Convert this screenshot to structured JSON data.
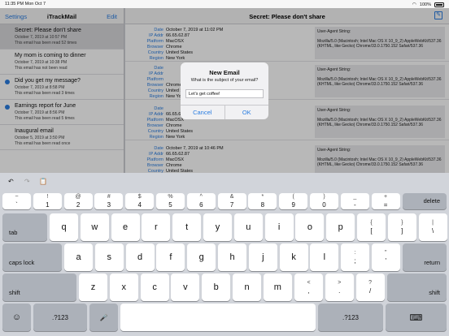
{
  "status_bar": {
    "time": "11:35 PM",
    "date": "Mon Oct 7",
    "battery": "100%"
  },
  "sidebar": {
    "left_button": "Settings",
    "title": "iTrackMail",
    "right_button": "Edit",
    "items": [
      {
        "subject": "Secret: Please don't share",
        "date": "October 7, 2019 at 10:57 PM",
        "read": "This email has been read 52 times",
        "unread": false,
        "selected": true
      },
      {
        "subject": "My mom is coming to dinner",
        "date": "October 7, 2019 at 10:38 PM",
        "read": "This email has not been read",
        "unread": false,
        "selected": false
      },
      {
        "subject": "Did you get my message?",
        "date": "October 7, 2019 at 8:58 PM",
        "read": "This email has been read 3 times",
        "unread": true,
        "selected": false
      },
      {
        "subject": "Earnings report for June",
        "date": "October 7, 2019 at 8:56 PM",
        "read": "This email has been read 5 times",
        "unread": true,
        "selected": false
      },
      {
        "subject": "Inaugural email",
        "date": "October 5, 2019 at 3:50 PM",
        "read": "This email has been read once",
        "unread": false,
        "selected": false
      }
    ]
  },
  "detail": {
    "title": "Secret: Please don't share",
    "entries": [
      {
        "date": "October 7, 2019 at 11:02 PM",
        "ip": "66.65.62.87",
        "platform": "MacOSX",
        "browser": "Chrome",
        "country": "United States",
        "region": "New York"
      },
      {
        "date": "",
        "ip": "",
        "platform": "",
        "browser": "Chrome",
        "country": "United St",
        "region": "New York"
      },
      {
        "date": "",
        "ip": "66.65.62.87",
        "platform": "MacOSX",
        "browser": "Chrome",
        "country": "United States",
        "region": "New York"
      },
      {
        "date": "October 7, 2019 at 10:46 PM",
        "ip": "66.65.62.87",
        "platform": "MacOSX",
        "browser": "Chrome",
        "country": "United States",
        "region": ""
      }
    ],
    "labels": {
      "date": "Date",
      "ip": "IP Addr",
      "platform": "Platform",
      "browser": "Browser",
      "country": "Country",
      "region": "Region"
    },
    "ua_title": "User-Agent String:",
    "ua_value": "Mozilla/5.0 (Macintosh; Intel Mac OS X 10_9_2) AppleWebKit/537.36 (KHTML, like Gecko) Chrome/33.0.1750.152 Safari/537.36"
  },
  "alert": {
    "title": "New Email",
    "message": "What is the subject of your email?",
    "input_value": "Let's get coffee!",
    "cancel": "Cancel",
    "ok": "OK"
  },
  "keyboard": {
    "row1": [
      {
        "top": "~",
        "bottom": "`"
      },
      {
        "top": "!",
        "bottom": "1"
      },
      {
        "top": "@",
        "bottom": "2"
      },
      {
        "top": "#",
        "bottom": "3"
      },
      {
        "top": "$",
        "bottom": "4"
      },
      {
        "top": "%",
        "bottom": "5"
      },
      {
        "top": "^",
        "bottom": "6"
      },
      {
        "top": "&",
        "bottom": "7"
      },
      {
        "top": "*",
        "bottom": "8"
      },
      {
        "top": "(",
        "bottom": "9"
      },
      {
        "top": ")",
        "bottom": "0"
      },
      {
        "top": "_",
        "bottom": "-"
      },
      {
        "top": "+",
        "bottom": "="
      }
    ],
    "delete": "delete",
    "tab": "tab",
    "row2": [
      "q",
      "w",
      "e",
      "r",
      "t",
      "y",
      "u",
      "i",
      "o",
      "p"
    ],
    "row2_extra": [
      {
        "top": "{",
        "bottom": "["
      },
      {
        "top": "}",
        "bottom": "]"
      },
      {
        "top": "|",
        "bottom": "\\"
      }
    ],
    "caps": "caps lock",
    "row3": [
      "a",
      "s",
      "d",
      "f",
      "g",
      "h",
      "j",
      "k",
      "l"
    ],
    "row3_extra": [
      {
        "top": ":",
        "bottom": ";"
      },
      {
        "top": "\"",
        "bottom": "'"
      }
    ],
    "return": "return",
    "shift": "shift",
    "row4": [
      "z",
      "x",
      "c",
      "v",
      "b",
      "n",
      "m"
    ],
    "row4_extra": [
      {
        "top": "<",
        "bottom": ","
      },
      {
        "top": ">",
        "bottom": "."
      },
      {
        "top": "?",
        "bottom": "/"
      }
    ],
    "numbers": ".?123",
    "emoji": "☺",
    "mic": "🎤",
    "hide": "⌨"
  }
}
